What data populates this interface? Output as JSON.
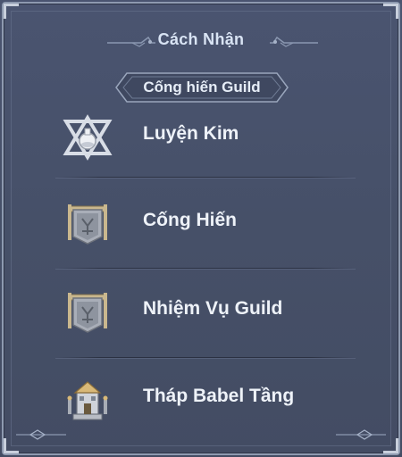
{
  "panel": {
    "title": "Cách Nhận",
    "subheader": "Cống hiến Guild"
  },
  "entries": [
    {
      "label": "Luyện Kim",
      "icon": "alchemy-hexagram-icon"
    },
    {
      "label": "Cống Hiến",
      "icon": "guild-banner-shield-icon"
    },
    {
      "label": "Nhiệm Vụ Guild",
      "icon": "guild-banner-shield-icon"
    },
    {
      "label": "Tháp Babel Tầng",
      "icon": "babel-tower-icon"
    }
  ],
  "colors": {
    "panel_bg": "#465068",
    "frame": "#8e9ab0",
    "text": "#eef2f8",
    "title_text": "#d9e4f4"
  }
}
